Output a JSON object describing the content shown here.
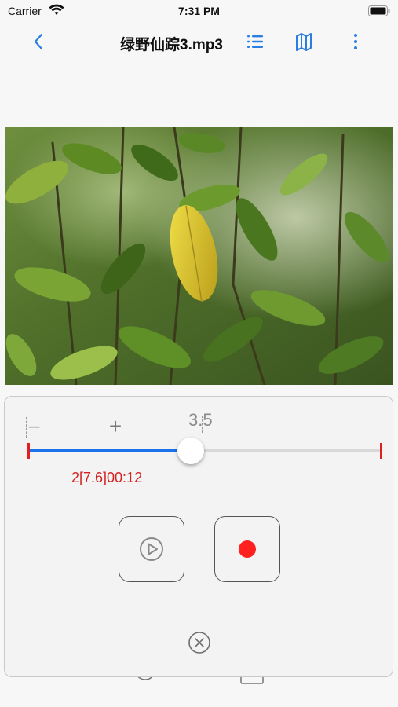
{
  "status_bar": {
    "carrier": "Carrier",
    "time": "7:31 PM"
  },
  "nav": {
    "title": "绿野仙踪3.mp3",
    "icons": [
      "chevron-left-icon",
      "list-icon",
      "map-icon",
      "more-vertical-icon"
    ],
    "accent": "#2a7de1"
  },
  "artwork": {
    "description_icon": "album-artwork"
  },
  "player": {
    "minus_label": "–",
    "plus_label": "+",
    "speed": "3.5",
    "position_label": "2[7.6]00:12",
    "progress": 0.46,
    "colors": {
      "track_fill": "#1a73e8",
      "marker": "#e02020",
      "record": "#ff2020",
      "position_text": "#d42020"
    }
  }
}
